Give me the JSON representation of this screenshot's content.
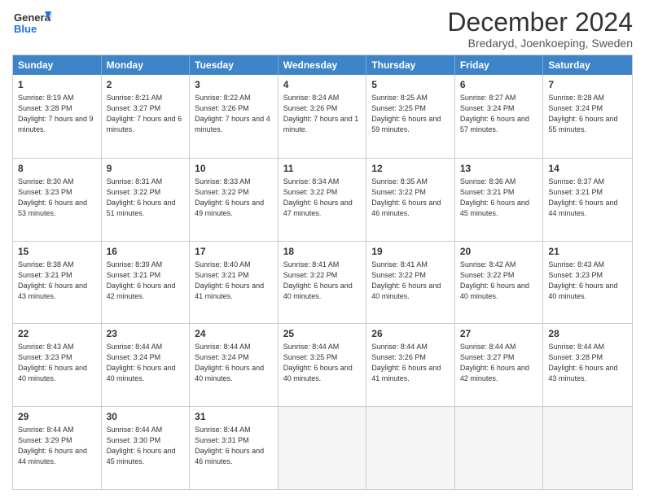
{
  "header": {
    "logo_line1": "General",
    "logo_line2": "Blue",
    "month": "December 2024",
    "location": "Bredaryd, Joenkoeping, Sweden"
  },
  "weekdays": [
    "Sunday",
    "Monday",
    "Tuesday",
    "Wednesday",
    "Thursday",
    "Friday",
    "Saturday"
  ],
  "weeks": [
    [
      {
        "day": "1",
        "rise": "8:19 AM",
        "set": "3:28 PM",
        "daylight": "7 hours and 9 minutes."
      },
      {
        "day": "2",
        "rise": "8:21 AM",
        "set": "3:27 PM",
        "daylight": "7 hours and 6 minutes."
      },
      {
        "day": "3",
        "rise": "8:22 AM",
        "set": "3:26 PM",
        "daylight": "7 hours and 4 minutes."
      },
      {
        "day": "4",
        "rise": "8:24 AM",
        "set": "3:26 PM",
        "daylight": "7 hours and 1 minute."
      },
      {
        "day": "5",
        "rise": "8:25 AM",
        "set": "3:25 PM",
        "daylight": "6 hours and 59 minutes."
      },
      {
        "day": "6",
        "rise": "8:27 AM",
        "set": "3:24 PM",
        "daylight": "6 hours and 57 minutes."
      },
      {
        "day": "7",
        "rise": "8:28 AM",
        "set": "3:24 PM",
        "daylight": "6 hours and 55 minutes."
      }
    ],
    [
      {
        "day": "8",
        "rise": "8:30 AM",
        "set": "3:23 PM",
        "daylight": "6 hours and 53 minutes."
      },
      {
        "day": "9",
        "rise": "8:31 AM",
        "set": "3:22 PM",
        "daylight": "6 hours and 51 minutes."
      },
      {
        "day": "10",
        "rise": "8:33 AM",
        "set": "3:22 PM",
        "daylight": "6 hours and 49 minutes."
      },
      {
        "day": "11",
        "rise": "8:34 AM",
        "set": "3:22 PM",
        "daylight": "6 hours and 47 minutes."
      },
      {
        "day": "12",
        "rise": "8:35 AM",
        "set": "3:22 PM",
        "daylight": "6 hours and 46 minutes."
      },
      {
        "day": "13",
        "rise": "8:36 AM",
        "set": "3:21 PM",
        "daylight": "6 hours and 45 minutes."
      },
      {
        "day": "14",
        "rise": "8:37 AM",
        "set": "3:21 PM",
        "daylight": "6 hours and 44 minutes."
      }
    ],
    [
      {
        "day": "15",
        "rise": "8:38 AM",
        "set": "3:21 PM",
        "daylight": "6 hours and 43 minutes."
      },
      {
        "day": "16",
        "rise": "8:39 AM",
        "set": "3:21 PM",
        "daylight": "6 hours and 42 minutes."
      },
      {
        "day": "17",
        "rise": "8:40 AM",
        "set": "3:21 PM",
        "daylight": "6 hours and 41 minutes."
      },
      {
        "day": "18",
        "rise": "8:41 AM",
        "set": "3:22 PM",
        "daylight": "6 hours and 40 minutes."
      },
      {
        "day": "19",
        "rise": "8:41 AM",
        "set": "3:22 PM",
        "daylight": "6 hours and 40 minutes."
      },
      {
        "day": "20",
        "rise": "8:42 AM",
        "set": "3:22 PM",
        "daylight": "6 hours and 40 minutes."
      },
      {
        "day": "21",
        "rise": "8:43 AM",
        "set": "3:23 PM",
        "daylight": "6 hours and 40 minutes."
      }
    ],
    [
      {
        "day": "22",
        "rise": "8:43 AM",
        "set": "3:23 PM",
        "daylight": "6 hours and 40 minutes."
      },
      {
        "day": "23",
        "rise": "8:44 AM",
        "set": "3:24 PM",
        "daylight": "6 hours and 40 minutes."
      },
      {
        "day": "24",
        "rise": "8:44 AM",
        "set": "3:24 PM",
        "daylight": "6 hours and 40 minutes."
      },
      {
        "day": "25",
        "rise": "8:44 AM",
        "set": "3:25 PM",
        "daylight": "6 hours and 40 minutes."
      },
      {
        "day": "26",
        "rise": "8:44 AM",
        "set": "3:26 PM",
        "daylight": "6 hours and 41 minutes."
      },
      {
        "day": "27",
        "rise": "8:44 AM",
        "set": "3:27 PM",
        "daylight": "6 hours and 42 minutes."
      },
      {
        "day": "28",
        "rise": "8:44 AM",
        "set": "3:28 PM",
        "daylight": "6 hours and 43 minutes."
      }
    ],
    [
      {
        "day": "29",
        "rise": "8:44 AM",
        "set": "3:29 PM",
        "daylight": "6 hours and 44 minutes."
      },
      {
        "day": "30",
        "rise": "8:44 AM",
        "set": "3:30 PM",
        "daylight": "6 hours and 45 minutes."
      },
      {
        "day": "31",
        "rise": "8:44 AM",
        "set": "3:31 PM",
        "daylight": "6 hours and 46 minutes."
      },
      null,
      null,
      null,
      null
    ]
  ],
  "labels": {
    "sunrise": "Sunrise:",
    "sunset": "Sunset:",
    "daylight": "Daylight:"
  }
}
